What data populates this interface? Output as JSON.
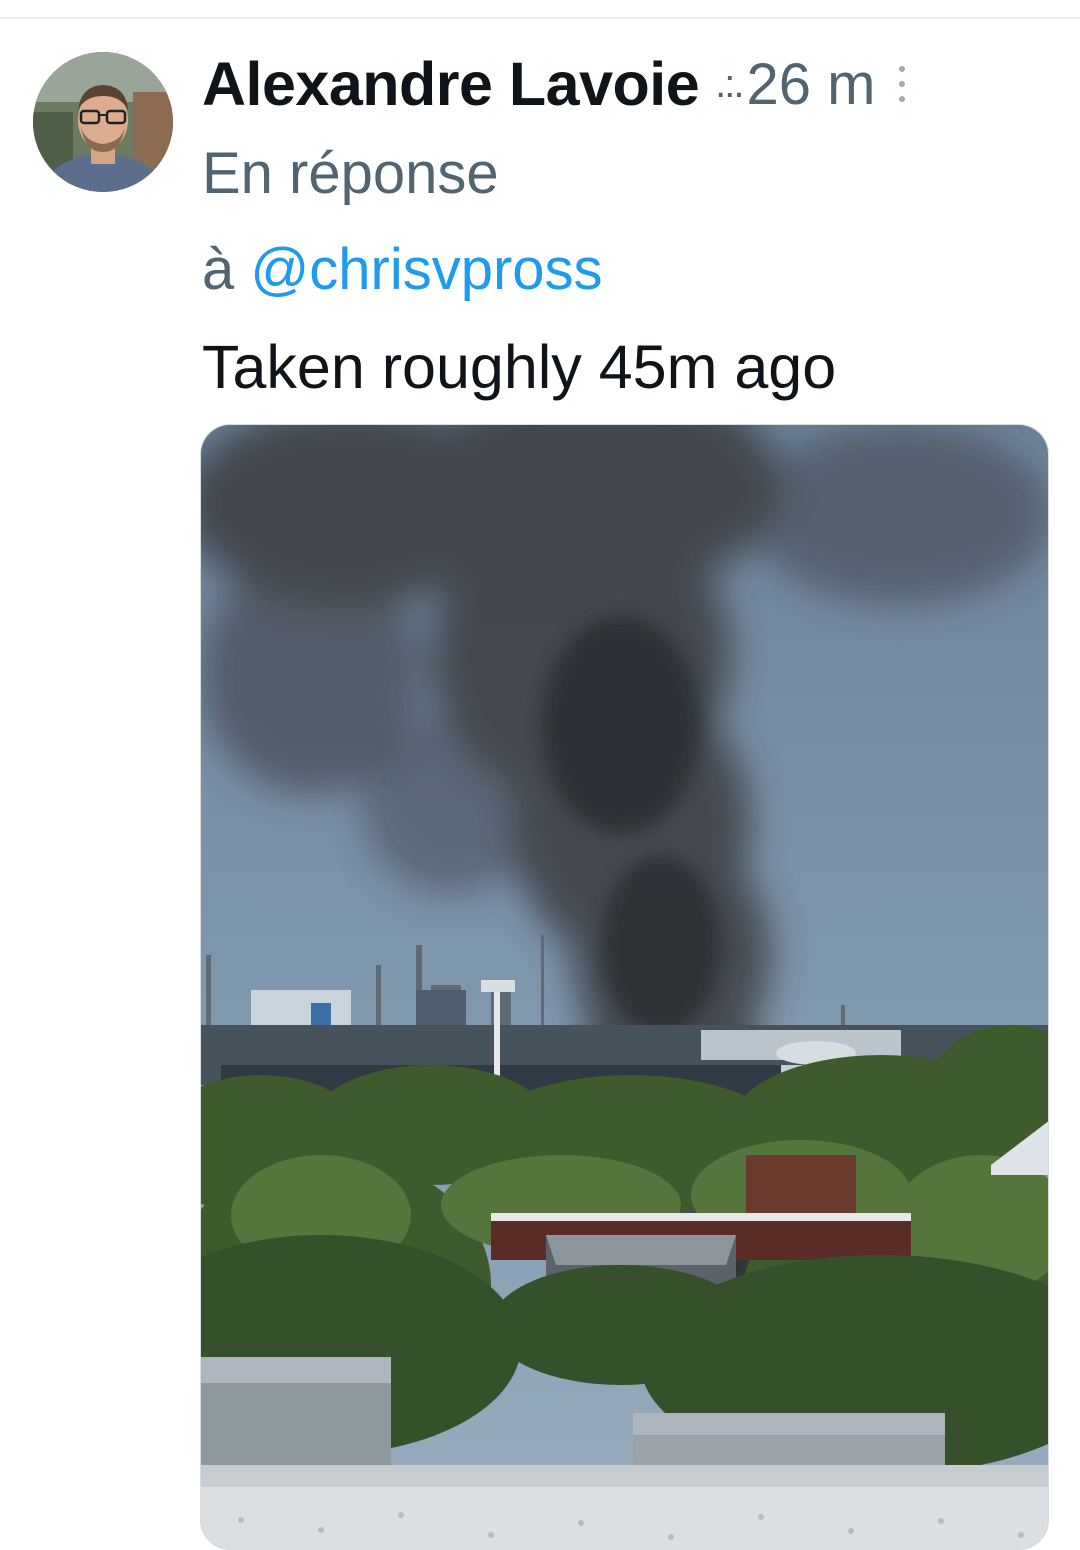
{
  "tweet": {
    "author_name": "Alexandre Lavoie",
    "truncation": ".:.",
    "timestamp": "26 m",
    "reply_prefix": "En réponse",
    "reply_to_word": "à",
    "reply_handle": "@chrisvpross",
    "text": "Taken roughly 45m ago",
    "more_icon": "more-vertical-icon",
    "media_alt": "photo"
  },
  "colors": {
    "text_primary": "#0f1419",
    "text_secondary": "#536471",
    "link": "#1d9bf0"
  }
}
